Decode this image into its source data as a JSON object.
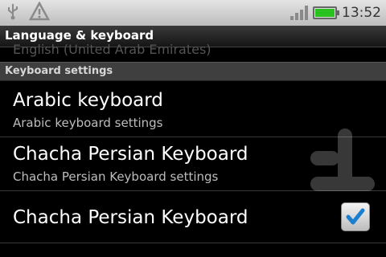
{
  "status_bar": {
    "left_icons": [
      "usb-icon",
      "warning-icon"
    ],
    "right_icons": [
      "signal-icon",
      "battery-icon"
    ],
    "time": "13:52",
    "battery_level": 1.0
  },
  "title_bar": {
    "title": "Language & keyboard"
  },
  "list": {
    "cutoff_item_text": "English (United Arab Emirates)",
    "section_header": "Keyboard settings",
    "items": [
      {
        "title": "Arabic keyboard",
        "subtitle": "Arabic keyboard settings"
      },
      {
        "title": "Chacha Persian Keyboard",
        "subtitle": "Chacha Persian Keyboard settings"
      },
      {
        "title": "Chacha Persian Keyboard",
        "checked": true
      }
    ]
  },
  "colors": {
    "background": "#000000",
    "battery_fill": "#28c11e",
    "checkmark": "#1a7fd0"
  }
}
